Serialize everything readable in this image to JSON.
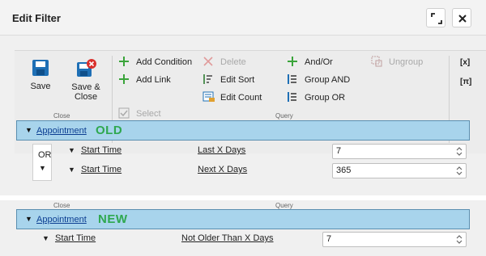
{
  "window": {
    "title": "Edit Filter"
  },
  "ribbon": {
    "close_group": {
      "label": "Close",
      "save_label": "Save",
      "save_close_line1": "Save &",
      "save_close_line2": "Close",
      "select_label": "Select"
    },
    "query_group": {
      "label": "Query",
      "add_condition": "Add Condition",
      "add_link": "Add Link",
      "delete": "Delete",
      "edit_sort": "Edit Sort",
      "edit_count": "Edit Count",
      "and_or": "And/Or",
      "group_and": "Group AND",
      "group_or": "Group OR",
      "ungroup": "Ungroup"
    },
    "right_icons": [
      "[x]",
      "[π]"
    ]
  },
  "old_filter": {
    "entity": "Appointment",
    "badge": "OLD",
    "group_operator": "OR",
    "conditions": [
      {
        "field": "Start Time",
        "operator": "Last X Days",
        "value": "7"
      },
      {
        "field": "Start Time",
        "operator": "Next X Days",
        "value": "365"
      }
    ]
  },
  "new_filter": {
    "close_label": "Close",
    "query_label": "Query",
    "entity": "Appointment",
    "badge": "NEW",
    "conditions": [
      {
        "field": "Start Time",
        "operator": "Not Older Than X Days",
        "value": "7"
      }
    ]
  },
  "colors": {
    "accent_green": "#2fa84f",
    "entity_bar": "#a8d4ec",
    "entity_border": "#5a8fb0",
    "save_blue": "#1e6fb5",
    "close_red": "#d9302c"
  }
}
